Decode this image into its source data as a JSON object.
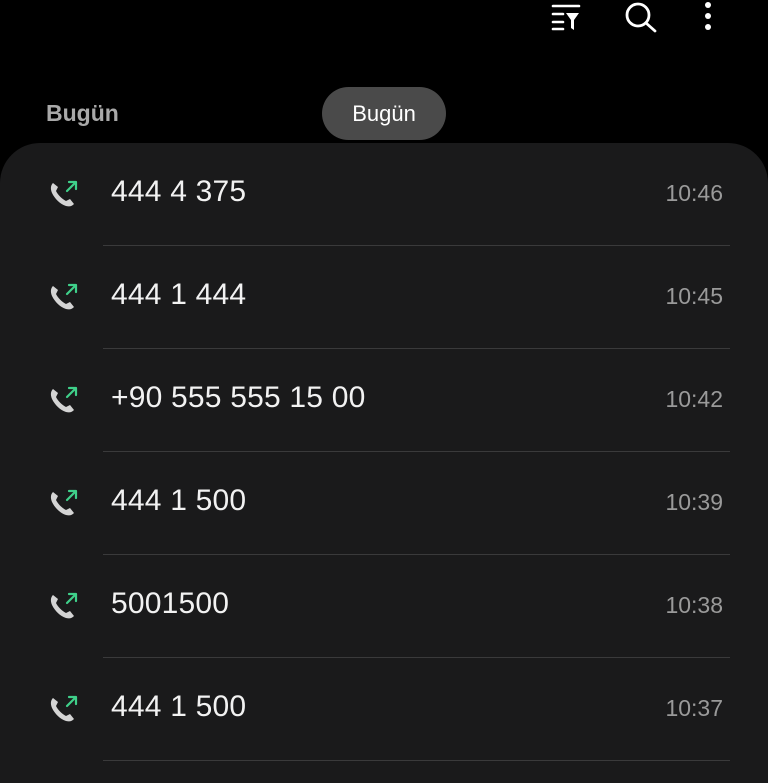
{
  "toolbar": {
    "icons": [
      "filter-icon",
      "search-icon",
      "more-options-icon"
    ]
  },
  "section": {
    "header": "Bugün",
    "chip": "Bugün"
  },
  "colors": {
    "background": "#000000",
    "card": "#1a1a1b",
    "outgoing_arrow": "#3fd08a",
    "phone_glyph": "#d4d4d4"
  },
  "calls": [
    {
      "number": "444 4 375",
      "time": "10:46",
      "type": "outgoing"
    },
    {
      "number": "444 1 444",
      "time": "10:45",
      "type": "outgoing"
    },
    {
      "number": "+90 555 555 15 00",
      "time": "10:42",
      "type": "outgoing"
    },
    {
      "number": "444 1 500",
      "time": "10:39",
      "type": "outgoing"
    },
    {
      "number": "5001500",
      "time": "10:38",
      "type": "outgoing"
    },
    {
      "number": "444 1 500",
      "time": "10:37",
      "type": "outgoing"
    }
  ]
}
